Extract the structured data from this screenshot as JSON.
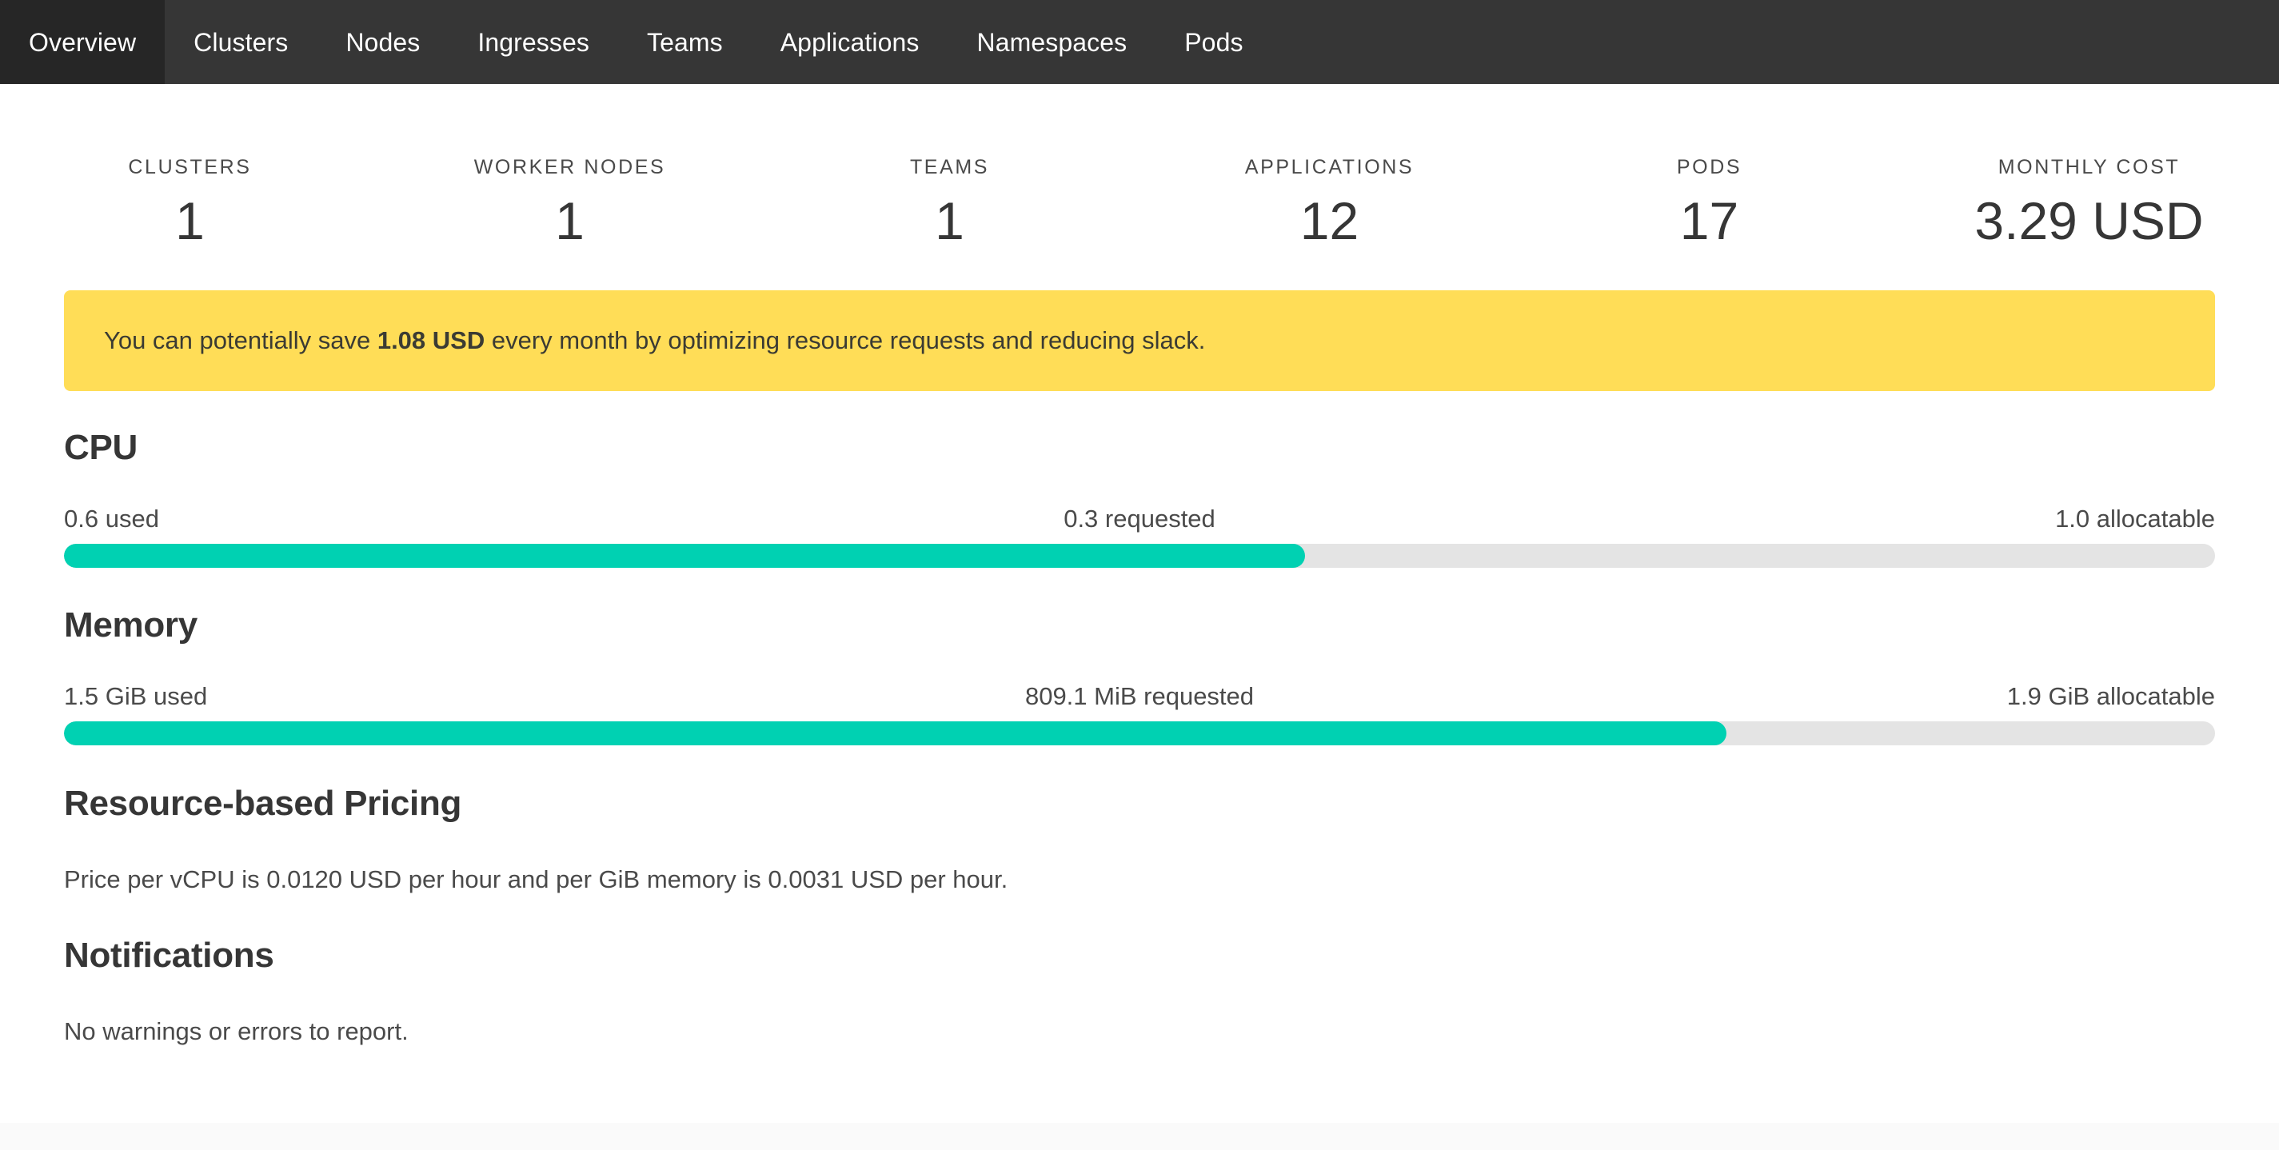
{
  "navbar": {
    "items": [
      {
        "label": "Overview",
        "active": true
      },
      {
        "label": "Clusters",
        "active": false
      },
      {
        "label": "Nodes",
        "active": false
      },
      {
        "label": "Ingresses",
        "active": false
      },
      {
        "label": "Teams",
        "active": false
      },
      {
        "label": "Applications",
        "active": false
      },
      {
        "label": "Namespaces",
        "active": false
      },
      {
        "label": "Pods",
        "active": false
      }
    ]
  },
  "stats": [
    {
      "label": "CLUSTERS",
      "value": "1"
    },
    {
      "label": "WORKER NODES",
      "value": "1"
    },
    {
      "label": "TEAMS",
      "value": "1"
    },
    {
      "label": "APPLICATIONS",
      "value": "12"
    },
    {
      "label": "PODS",
      "value": "17"
    },
    {
      "label": "MONTHLY COST",
      "value": "3.29 USD"
    }
  ],
  "banner": {
    "prefix": "You can potentially save ",
    "amount": "1.08 USD",
    "suffix": " every month by optimizing resource requests and reducing slack.",
    "background_color": "#ffdd57"
  },
  "cpu": {
    "title": "CPU",
    "used_label": "0.6 used",
    "requested_label": "0.3 requested",
    "allocatable_label": "1.0 allocatable",
    "fill_percent": "57.7%",
    "fill_color": "#00d1b2",
    "track_color": "#e4e4e4"
  },
  "memory": {
    "title": "Memory",
    "used_label": "1.5 GiB used",
    "requested_label": "809.1 MiB requested",
    "allocatable_label": "1.9 GiB allocatable",
    "fill_percent": "77.3%",
    "fill_color": "#00d1b2",
    "track_color": "#e4e4e4"
  },
  "pricing": {
    "title": "Resource-based Pricing",
    "text": "Price per vCPU is 0.0120 USD per hour and per GiB memory is 0.0031 USD per hour."
  },
  "notifications": {
    "title": "Notifications",
    "text": "No warnings or errors to report."
  }
}
